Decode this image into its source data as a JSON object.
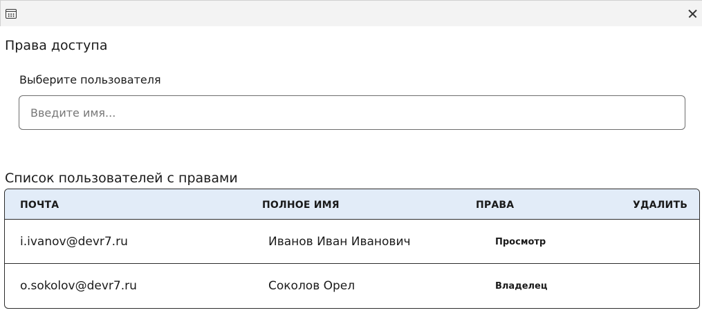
{
  "window": {
    "app_icon": "calendar-grid-icon",
    "close_icon": "close-icon"
  },
  "page": {
    "title": "Права доступа"
  },
  "user_select": {
    "label": "Выберите пользователя",
    "placeholder": "Введите имя...",
    "value": ""
  },
  "users_list": {
    "title": "Список пользователей с правами",
    "columns": {
      "email": "ПОЧТА",
      "full_name": "ПОЛНОЕ ИМЯ",
      "rights": "ПРАВА",
      "delete": "УДАЛИТЬ"
    },
    "rows": [
      {
        "email": "i.ivanov@devr7.ru",
        "full_name": "Иванов Иван Иванович",
        "rights": "Просмотр"
      },
      {
        "email": "o.sokolov@devr7.ru",
        "full_name": "Соколов Орел",
        "rights": "Владелец"
      }
    ]
  }
}
